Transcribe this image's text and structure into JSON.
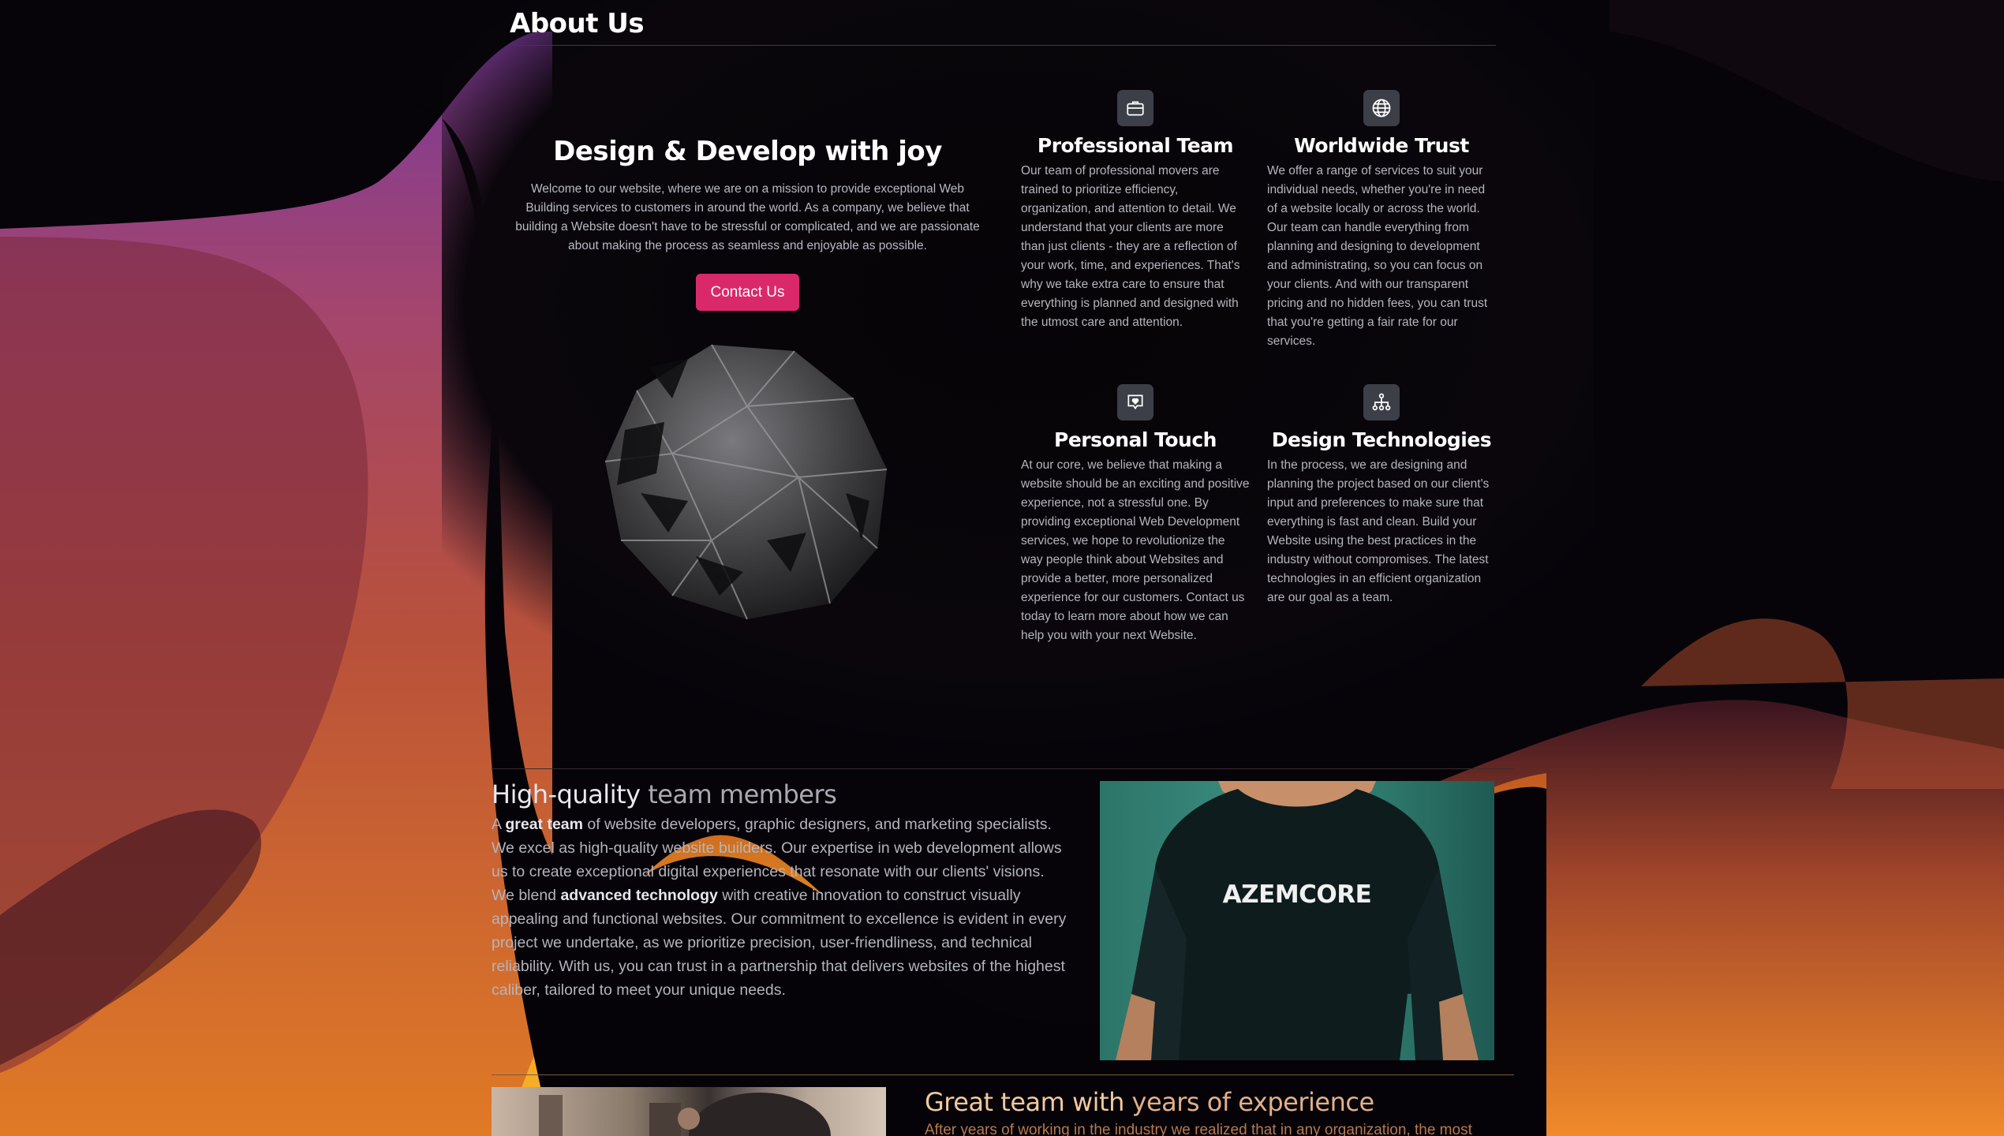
{
  "about": {
    "title": "About Us",
    "heading": "Design & Develop with joy",
    "intro": "Welcome to our website, where we are on a mission to provide exceptional Web Building services to customers in around the world. As a company, we believe that building a Website doesn't have to be stressful or complicated, and we are passionate about making the process as seamless and enjoyable as possible.",
    "contact_label": "Contact Us",
    "accent_color": "#d9296a"
  },
  "features": [
    {
      "icon": "briefcase-icon",
      "title": "Professional Team",
      "text": "Our team of professional movers are trained to prioritize efficiency, organization, and attention to detail. We understand that your clients are more than just clients - they are a reflection of your work, time, and experiences. That's why we take extra care to ensure that everything is planned and designed with the utmost care and attention."
    },
    {
      "icon": "globe-icon",
      "title": "Worldwide Trust",
      "text": "We offer a range of services to suit your individual needs, whether you're in need of a website locally or across the world. Our team can handle everything from planning and designing to development and administrating, so you can focus on your clients. And with our transparent pricing and no hidden fees, you can trust that you're getting a fair rate for our services."
    },
    {
      "icon": "heart-message-icon",
      "title": "Personal Touch",
      "text": "At our core, we believe that making a website should be an exciting and positive experience, not a stressful one. By providing exceptional Web Development services, we hope to revolutionize the way people think about Websites and provide a better, more personalized experience for our customers. Contact us today to learn more about how we can help you with your next Website."
    },
    {
      "icon": "sitemap-icon",
      "title": "Design Technologies",
      "text": "In the process, we are designing and planning the project based on our client's input and preferences to make sure that everything is fast and clean. Build your Website using the best practices in the industry without compromises. The latest technologies in an efficient organization are our goal as a team."
    }
  ],
  "team": {
    "title_a": "High-quality",
    "title_b": " team members",
    "text_1": "A ",
    "bold_1": "great team",
    "text_2": " of website developers, graphic designers, and marketing specialists. We excel as high-quality website builders. Our expertise in web development allows us to create exceptional digital experiences that resonate with our clients' visions. We blend ",
    "bold_2": "advanced technology",
    "text_3": " with creative innovation to construct visually appealing and functional websites. Our commitment to excellence is evident in every project we undertake, as we prioritize precision, user-friendliness, and technical reliability. With us, you can trust in a partnership that delivers websites of the highest caliber, tailored to meet your unique needs.",
    "shirt_text": "AZEMCORE"
  },
  "experience": {
    "title_a": "Great team with",
    "title_b": " years of experience",
    "text": "After years of working in the industry we realized that in any organization, the most"
  }
}
